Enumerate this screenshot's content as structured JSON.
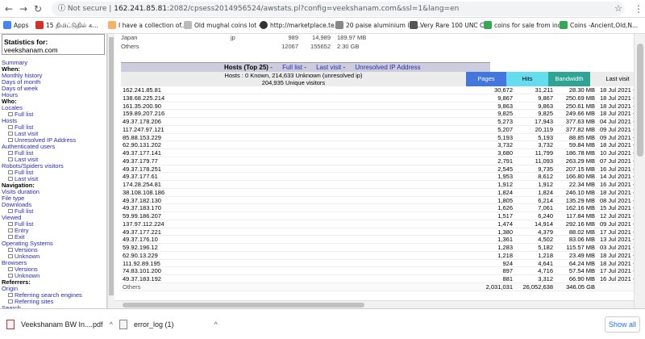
{
  "browser": {
    "nav_back": "←",
    "nav_forward": "→",
    "nav_reload": "↻",
    "security": "Not secure",
    "separator": "|",
    "host": "162.241.85.81",
    "path": ":2082/cpsess2014956524/awstats.pl?config=veekshanam.com&ssl=1&lang=en",
    "star_icon": "☆",
    "menu_icon": "⋮"
  },
  "bookmarks": [
    {
      "label": "Apps",
      "color": "#4285f4"
    },
    {
      "label": "15 திமிட்டுதில் சு...",
      "color": "#d93025"
    },
    {
      "label": "I have a collection of...",
      "color": "#f6b26b"
    },
    {
      "label": "Old mughal coins lot -...",
      "color": "#999999"
    },
    {
      "label": "http://marketplace.te...",
      "color": "#333333"
    },
    {
      "label": "20 paise aluminium lot...",
      "color": "#666666"
    },
    {
      "label": "Very Rare 100 UNC C...",
      "color": "#555555"
    },
    {
      "label": "coins for sale from ind...",
      "color": "#34a853"
    },
    {
      "label": "Coins -Ancient,Old,N...",
      "color": "#34a853"
    }
  ],
  "sidebar": {
    "title": "Statistics for:",
    "host": "veekshanam.com",
    "items": [
      {
        "label": "Summary",
        "type": "link"
      },
      {
        "label": "When:",
        "type": "head"
      },
      {
        "label": "Monthly history",
        "type": "link"
      },
      {
        "label": "Days of month",
        "type": "link"
      },
      {
        "label": "Days of week",
        "type": "link"
      },
      {
        "label": "Hours",
        "type": "link"
      },
      {
        "label": "Who:",
        "type": "head"
      },
      {
        "label": "Locales",
        "type": "link"
      },
      {
        "label": "Full list",
        "type": "sub"
      },
      {
        "label": "Hosts",
        "type": "link"
      },
      {
        "label": "Full list",
        "type": "sub"
      },
      {
        "label": "Last visit",
        "type": "sub"
      },
      {
        "label": "Unresolved IP Address",
        "type": "sub"
      },
      {
        "label": "Authenticated users",
        "type": "link"
      },
      {
        "label": "Full list",
        "type": "sub"
      },
      {
        "label": "Last visit",
        "type": "sub"
      },
      {
        "label": "Robots/Spiders visitors",
        "type": "link"
      },
      {
        "label": "Full list",
        "type": "sub"
      },
      {
        "label": "Last visit",
        "type": "sub"
      },
      {
        "label": "Navigation:",
        "type": "head"
      },
      {
        "label": "Visits duration",
        "type": "link"
      },
      {
        "label": "File type",
        "type": "link"
      },
      {
        "label": "Downloads",
        "type": "link"
      },
      {
        "label": "Full list",
        "type": "sub"
      },
      {
        "label": "Viewed",
        "type": "link"
      },
      {
        "label": "Full list",
        "type": "sub"
      },
      {
        "label": "Entry",
        "type": "sub"
      },
      {
        "label": "Exit",
        "type": "sub"
      },
      {
        "label": "Operating Systems",
        "type": "link"
      },
      {
        "label": "Versions",
        "type": "sub"
      },
      {
        "label": "Unknown",
        "type": "sub"
      },
      {
        "label": "Browsers",
        "type": "link"
      },
      {
        "label": "Versions",
        "type": "sub"
      },
      {
        "label": "Unknown",
        "type": "sub"
      },
      {
        "label": "Referrers:",
        "type": "head"
      },
      {
        "label": "Origin",
        "type": "link"
      },
      {
        "label": "Referring search engines",
        "type": "sub"
      },
      {
        "label": "Referring sites",
        "type": "sub"
      },
      {
        "label": "Search",
        "type": "link"
      },
      {
        "label": "Search Keyphrases",
        "type": "sub"
      }
    ]
  },
  "previous_table": {
    "row1": {
      "name": "Japan",
      "code": "jp",
      "pages": "989",
      "hits": "14,989",
      "bandwidth": "189.97 MB"
    },
    "row2": {
      "name": "Others",
      "pages": "12067",
      "hits": "155652",
      "bandwidth": "2.30 GB"
    }
  },
  "hosts_section": {
    "title": "Hosts (Top 25)",
    "links": [
      "Full list",
      "Last visit",
      "Unresolved IP Address"
    ],
    "summary_line1": "Hosts : 0 Known, 214,633 Unknown (unresolved ip)",
    "summary_line2": "204,935 Unique visitors",
    "columns": [
      {
        "label": "Pages",
        "color": "#4477dd",
        "text_color": "#ffffff"
      },
      {
        "label": "Hits",
        "color": "#66ddee",
        "text_color": "#000000"
      },
      {
        "label": "Bandwidth",
        "color": "#2ea495",
        "text_color": "#ffffff"
      },
      {
        "label": "Last visit",
        "color": "#ececec",
        "text_color": "#000000"
      }
    ],
    "rows": [
      [
        "162.241.85.81",
        "30,672",
        "31,211",
        "28.30 MB",
        "18 Jul 2021 - 12:06"
      ],
      [
        "138.68.225.214",
        "9,867",
        "9,867",
        "250.69 MB",
        "18 Jul 2021 - 12:06"
      ],
      [
        "161.35.200.90",
        "9,863",
        "9,863",
        "250.61 MB",
        "18 Jul 2021 - 12:06"
      ],
      [
        "159.89.207.216",
        "9,825",
        "9,825",
        "249.66 MB",
        "18 Jul 2021 - 12:06"
      ],
      [
        "49.37.178.206",
        "5,273",
        "17,943",
        "377.63 MB",
        "04 Jul 2021 - 19:22"
      ],
      [
        "117.247.97.121",
        "5,207",
        "20,119",
        "377.82 MB",
        "09 Jul 2021 - 12:44"
      ],
      [
        "85.88.153.229",
        "5,193",
        "5,193",
        "88.85 MB",
        "09 Jul 2021 - 11:53"
      ],
      [
        "62.90.131.202",
        "3,732",
        "3,732",
        "59.84 MB",
        "18 Jul 2021 - 11:46"
      ],
      [
        "49.37.177.141",
        "3,680",
        "11,799",
        "186.78 MB",
        "10 Jul 2021 - 19:55"
      ],
      [
        "49.37.179.77",
        "2,791",
        "11,093",
        "263.29 MB",
        "07 Jul 2021 - 20:09"
      ],
      [
        "49.37.178.251",
        "2,545",
        "9,735",
        "207.15 MB",
        "16 Jul 2021 - 15:02"
      ],
      [
        "49.37.177.61",
        "1,953",
        "8,612",
        "166.80 MB",
        "14 Jul 2021 - 21:03"
      ],
      [
        "174.28.254.81",
        "1,912",
        "1,912",
        "22.34 MB",
        "16 Jul 2021 - 17:50"
      ],
      [
        "38.108.108.186",
        "1,824",
        "1,824",
        "246.10 MB",
        "18 Jul 2021 - 10:41"
      ],
      [
        "49.37.182.130",
        "1,805",
        "6,214",
        "135.29 MB",
        "08 Jul 2021 - 19:27"
      ],
      [
        "49.37.183.170",
        "1,626",
        "7,061",
        "162.16 MB",
        "15 Jul 2021 - 11:05"
      ],
      [
        "59.99.186.207",
        "1,517",
        "6,240",
        "117.84 MB",
        "12 Jul 2021 - 19:24"
      ],
      [
        "137.97.112.224",
        "1,474",
        "14,914",
        "292.16 MB",
        "09 Jul 2021 - 03:10"
      ],
      [
        "49.37.177.221",
        "1,380",
        "4,379",
        "88.02 MB",
        "17 Jul 2021 - 14:37"
      ],
      [
        "49.37.176.10",
        "1,361",
        "4,502",
        "83.06 MB",
        "13 Jul 2021 - 00:11"
      ],
      [
        "59.92.196.12",
        "1,283",
        "5,182",
        "115.57 MB",
        "03 Jul 2021 - 05:40"
      ],
      [
        "62.90.13.229",
        "1,218",
        "1,218",
        "23.49 MB",
        "18 Jul 2021 - 12:05"
      ],
      [
        "111.92.89.195",
        "924",
        "4,641",
        "64.24 MB",
        "18 Jul 2021 - 11:37"
      ],
      [
        "74.83.101.200",
        "897",
        "4,716",
        "57.54 MB",
        "17 Jul 2021 - 23:15"
      ],
      [
        "49.37.183.192",
        "881",
        "3,312",
        "66.90 MB",
        "16 Jul 2021 - 06:27"
      ]
    ],
    "others": [
      "Others",
      "2,031,031",
      "26,052,638",
      "346.05 GB",
      ""
    ]
  },
  "downloads": {
    "item1": "Veekshanam BW In....pdf",
    "item2": "error_log (1)",
    "chevron": "^",
    "show_all": "Show all",
    "close": "✕"
  }
}
